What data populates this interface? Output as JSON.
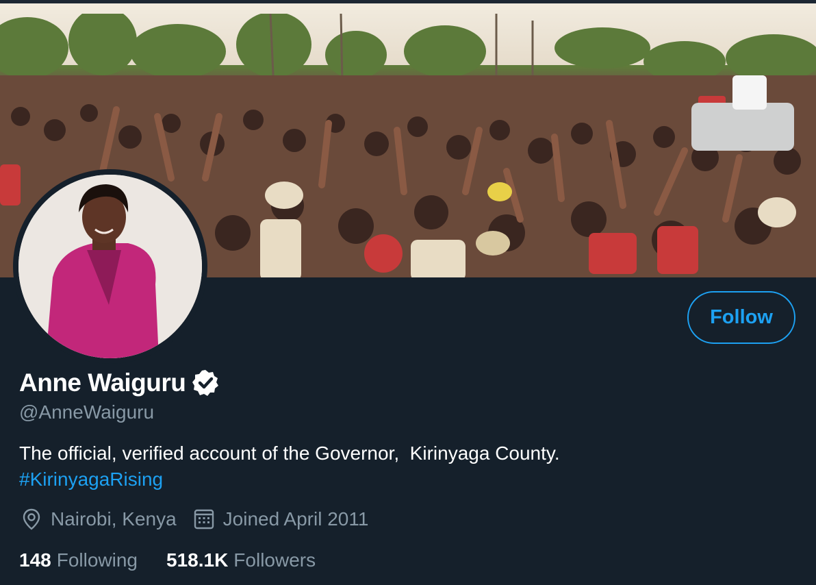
{
  "profile": {
    "display_name": "Anne Waiguru",
    "handle": "@AnneWaiguru",
    "bio_text": "The official, verified account of the Governor,  Kirinyaga County.",
    "bio_hashtag": "#KirinyagaRising",
    "location": "Nairobi, Kenya",
    "joined": "Joined April 2011"
  },
  "actions": {
    "follow_label": "Follow"
  },
  "stats": {
    "following_count": "148",
    "following_label": "Following",
    "followers_count": "518.1K",
    "followers_label": "Followers"
  },
  "icons": {
    "verified": "verified-badge-icon",
    "location": "location-pin-icon",
    "calendar": "calendar-icon"
  },
  "colors": {
    "background": "#15202b",
    "accent": "#1da1f2",
    "secondary_text": "#8899a6",
    "primary_text": "#ffffff"
  }
}
